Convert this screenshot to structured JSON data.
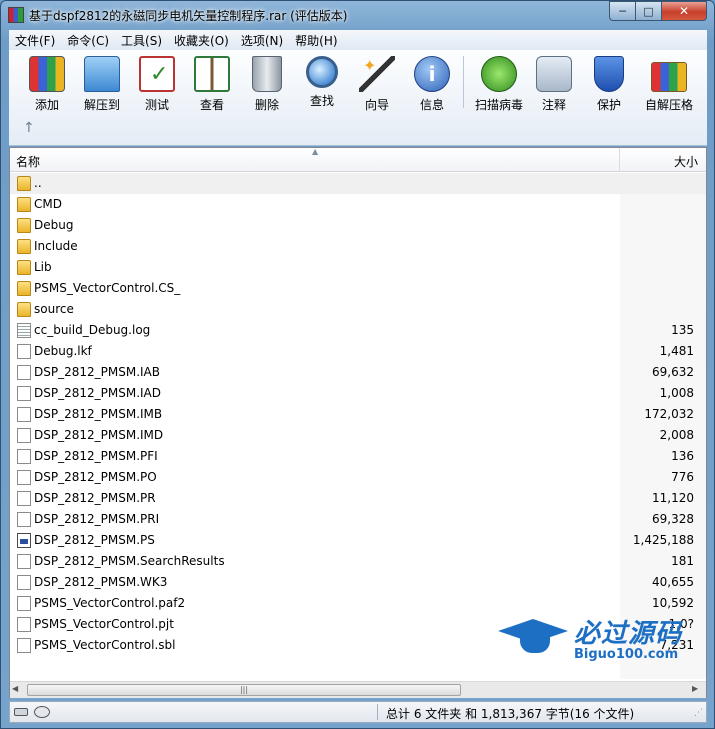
{
  "window": {
    "title": "基于dspf2812的永磁同步电机矢量控制程序.rar (评估版本)",
    "buttons": {
      "minimize": "─",
      "maximize": "□",
      "close": "✕"
    }
  },
  "menu": [
    {
      "label": "文件(F)"
    },
    {
      "label": "命令(C)"
    },
    {
      "label": "工具(S)"
    },
    {
      "label": "收藏夹(O)"
    },
    {
      "label": "选项(N)"
    },
    {
      "label": "帮助(H)"
    }
  ],
  "toolbar": {
    "tools": [
      {
        "label": "添加",
        "icon": "add-icon"
      },
      {
        "label": "解压到",
        "icon": "extract-icon"
      },
      {
        "label": "测试",
        "icon": "test-icon"
      },
      {
        "label": "查看",
        "icon": "view-icon"
      },
      {
        "label": "删除",
        "icon": "delete-icon"
      },
      {
        "label": "查找",
        "icon": "find-icon"
      },
      {
        "label": "向导",
        "icon": "wizard-icon"
      },
      {
        "label": "信息",
        "icon": "info-icon"
      },
      {
        "label": "扫描病毒",
        "icon": "virus-scan-icon"
      },
      {
        "label": "注释",
        "icon": "comment-icon"
      },
      {
        "label": "保护",
        "icon": "protect-icon"
      },
      {
        "label": "自解压格",
        "icon": "sfx-icon"
      }
    ],
    "up_glyph": "↑"
  },
  "list": {
    "columns": {
      "name": "名称",
      "size": "大小"
    },
    "rows": [
      {
        "name": "..",
        "size": "",
        "type": "folder"
      },
      {
        "name": "CMD",
        "size": "",
        "type": "folder"
      },
      {
        "name": "Debug",
        "size": "",
        "type": "folder"
      },
      {
        "name": "Include",
        "size": "",
        "type": "folder"
      },
      {
        "name": "Lib",
        "size": "",
        "type": "folder"
      },
      {
        "name": "PSMS_VectorControl.CS_",
        "size": "",
        "type": "folder"
      },
      {
        "name": "source",
        "size": "",
        "type": "folder"
      },
      {
        "name": "cc_build_Debug.log",
        "size": "135",
        "type": "text"
      },
      {
        "name": "Debug.lkf",
        "size": "1,481",
        "type": "file"
      },
      {
        "name": "DSP_2812_PMSM.IAB",
        "size": "69,632",
        "type": "file"
      },
      {
        "name": "DSP_2812_PMSM.IAD",
        "size": "1,008",
        "type": "file"
      },
      {
        "name": "DSP_2812_PMSM.IMB",
        "size": "172,032",
        "type": "file"
      },
      {
        "name": "DSP_2812_PMSM.IMD",
        "size": "2,008",
        "type": "file"
      },
      {
        "name": "DSP_2812_PMSM.PFI",
        "size": "136",
        "type": "file"
      },
      {
        "name": "DSP_2812_PMSM.PO",
        "size": "776",
        "type": "file"
      },
      {
        "name": "DSP_2812_PMSM.PR",
        "size": "11,120",
        "type": "file"
      },
      {
        "name": "DSP_2812_PMSM.PRI",
        "size": "69,328",
        "type": "file"
      },
      {
        "name": "DSP_2812_PMSM.PS",
        "size": "1,425,188",
        "type": "ps"
      },
      {
        "name": "DSP_2812_PMSM.SearchResults",
        "size": "181",
        "type": "file"
      },
      {
        "name": "DSP_2812_PMSM.WK3",
        "size": "40,655",
        "type": "file"
      },
      {
        "name": "PSMS_VectorControl.paf2",
        "size": "10,592",
        "type": "file"
      },
      {
        "name": "PSMS_VectorControl.pjt",
        "size": "1,0?",
        "type": "file"
      },
      {
        "name": "PSMS_VectorControl.sbl",
        "size": "7,231",
        "type": "file"
      }
    ]
  },
  "scrollbar": {
    "left": "◀",
    "grip": "|||",
    "right": "▶"
  },
  "status": {
    "text": "总计 6 文件夹 和 1,813,367 字节(16 个文件)",
    "grip": "⋰"
  },
  "watermark": {
    "title": "必过源码",
    "subtitle": "Biguo100.com"
  },
  "colors": {
    "accent": "#1d6fc4",
    "window_frame": "#76a3cc",
    "folder": "#e9b42a"
  }
}
